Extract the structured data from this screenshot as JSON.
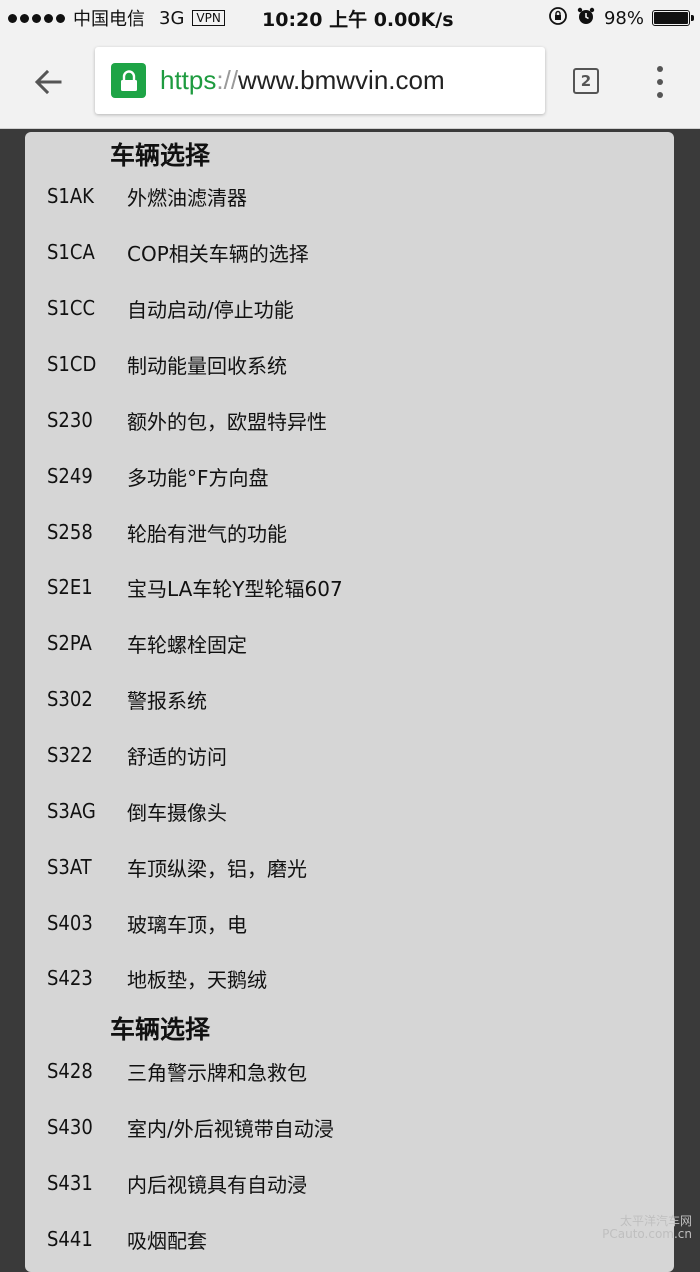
{
  "status_bar": {
    "carrier": "中国电信",
    "network": "3G",
    "vpn": "VPN",
    "time": "10:20 上午 0.00K/s",
    "battery": "98%"
  },
  "browser": {
    "url_scheme": "https",
    "url_sep": "://",
    "url_host": "www.bmwvin.com",
    "tab_count": "2"
  },
  "sections": [
    {
      "title": "车辆选择",
      "items": [
        {
          "code": "S1AK",
          "desc": "外燃油滤清器"
        },
        {
          "code": "S1CA",
          "desc": "COP相关车辆的选择"
        },
        {
          "code": "S1CC",
          "desc": "自动启动/停止功能"
        },
        {
          "code": "S1CD",
          "desc": "制动能量回收系统"
        },
        {
          "code": "S230",
          "desc": "额外的包，欧盟特异性"
        },
        {
          "code": "S249",
          "desc": "多功能°F方向盘"
        },
        {
          "code": "S258",
          "desc": "轮胎有泄气的功能"
        },
        {
          "code": "S2E1",
          "desc": "宝马LA车轮Y型轮辐607"
        },
        {
          "code": "S2PA",
          "desc": "车轮螺栓固定"
        },
        {
          "code": "S302",
          "desc": "警报系统"
        },
        {
          "code": "S322",
          "desc": "舒适的访问"
        },
        {
          "code": "S3AG",
          "desc": "倒车摄像头"
        },
        {
          "code": "S3AT",
          "desc": "车顶纵梁，铝，磨光"
        },
        {
          "code": "S403",
          "desc": "玻璃车顶，电"
        },
        {
          "code": "S423",
          "desc": "地板垫，天鹅绒"
        }
      ]
    },
    {
      "title": "车辆选择",
      "items": [
        {
          "code": "S428",
          "desc": "三角警示牌和急救包"
        },
        {
          "code": "S430",
          "desc": "室内/外后视镜带自动浸"
        },
        {
          "code": "S431",
          "desc": "内后视镜具有自动浸"
        },
        {
          "code": "S441",
          "desc": "吸烟配套"
        }
      ]
    }
  ],
  "watermark": {
    "line1": "太平洋汽车网",
    "line2": "PCauto.com.cn"
  },
  "colors": {
    "secure_green": "#1ea446",
    "url_green": "#1e9b3f",
    "card_bg": "#d6d6d6",
    "page_bg": "#3a3a3a"
  }
}
